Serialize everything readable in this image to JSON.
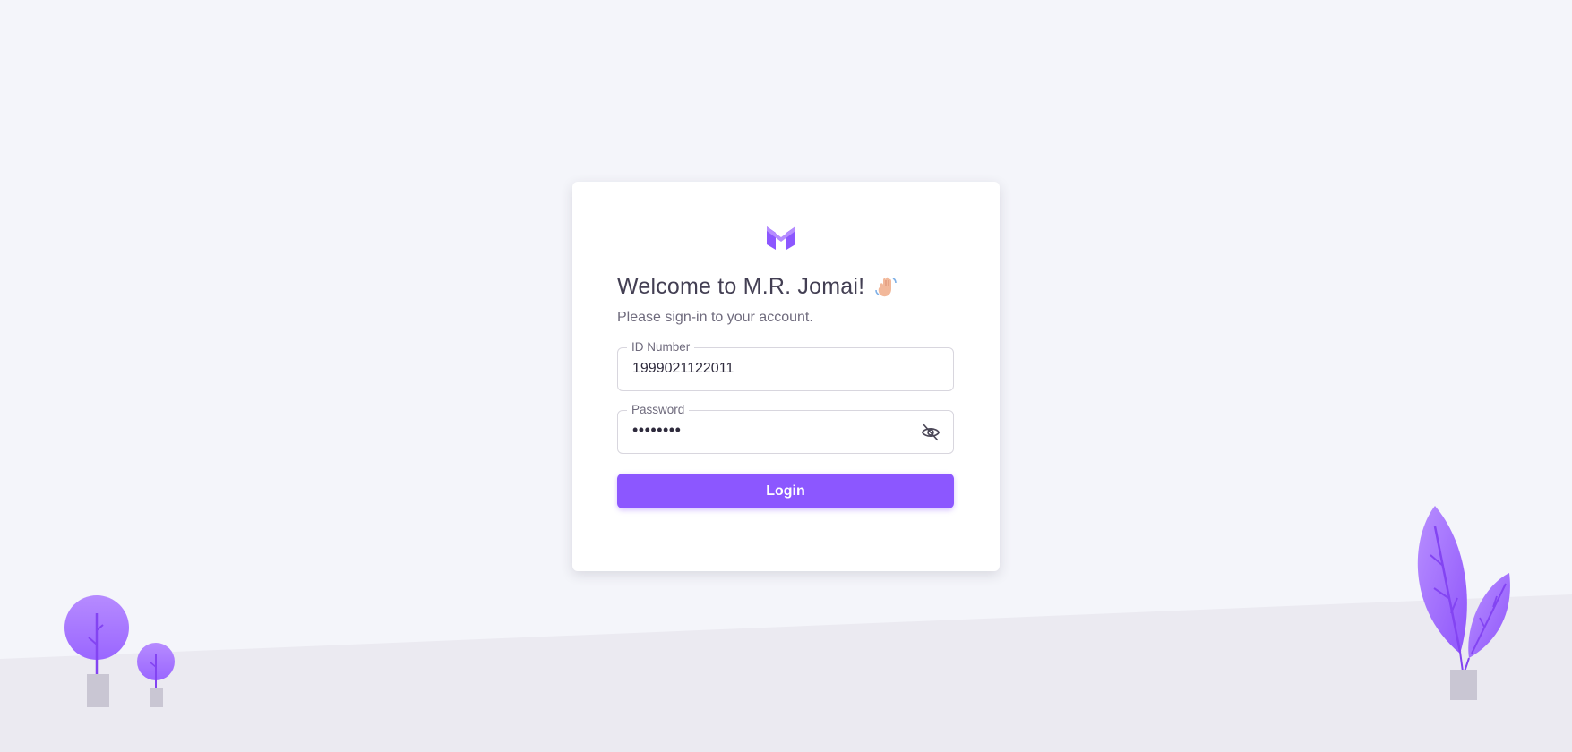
{
  "brand": {
    "logo_icon": "brand-m-logo-icon",
    "accent_color": "#8c57ff"
  },
  "header": {
    "title": "Welcome to M.R. Jomai!",
    "wave_icon": "waving-hand-icon",
    "subtitle": "Please sign-in to your account."
  },
  "form": {
    "id_number": {
      "label": "ID Number",
      "value": "1999021122011"
    },
    "password": {
      "label": "Password",
      "value": "••••••••",
      "visibility_icon": "eye-off-icon"
    },
    "login_label": "Login"
  },
  "decorations": {
    "left": "tree-plants-illustration",
    "right": "leaf-plant-illustration"
  }
}
